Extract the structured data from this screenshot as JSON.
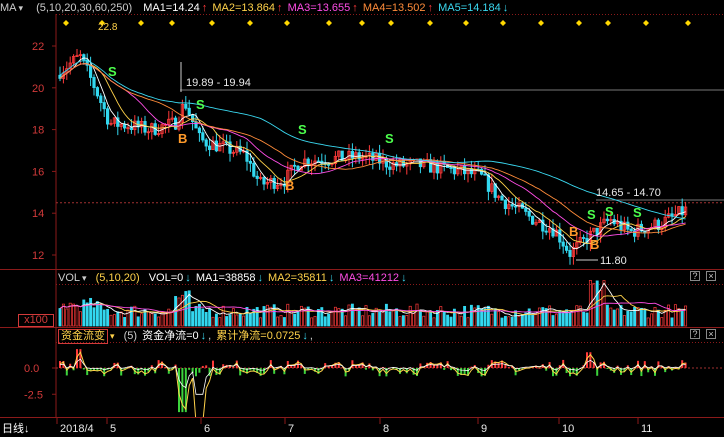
{
  "kline": {
    "indicator_name": "MA",
    "params": "(5,10,20,30,60,250)",
    "ma": [
      {
        "label": "MA1=14.24",
        "arrow": "↑",
        "color": "#ffffff"
      },
      {
        "label": "MA2=13.864",
        "arrow": "↑",
        "color": "#ffd24a"
      },
      {
        "label": "MA3=13.655",
        "arrow": "↑",
        "color": "#ff4de6"
      },
      {
        "label": "MA4=13.502",
        "arrow": "↑",
        "color": "#ff8c3a"
      },
      {
        "label": "MA5=14.184",
        "arrow": "↓",
        "color": "#3ad8f0"
      }
    ],
    "y_ticks": [
      "22",
      "20",
      "18",
      "16",
      "14",
      "12"
    ],
    "annotations": {
      "high_range": "19.89 - 19.94",
      "right_range": "14.65 - 14.70",
      "low": "11.80",
      "top_value": "22.8"
    },
    "signals": [
      {
        "type": "S",
        "x": 108,
        "y": 76
      },
      {
        "type": "S",
        "x": 196,
        "y": 109
      },
      {
        "type": "S",
        "x": 298,
        "y": 134
      },
      {
        "type": "S",
        "x": 385,
        "y": 143
      },
      {
        "type": "S",
        "x": 587,
        "y": 219
      },
      {
        "type": "S",
        "x": 605,
        "y": 216
      },
      {
        "type": "S",
        "x": 633,
        "y": 217
      },
      {
        "type": "B",
        "x": 178,
        "y": 143
      },
      {
        "type": "B",
        "x": 285,
        "y": 190
      },
      {
        "type": "B",
        "x": 569,
        "y": 236
      },
      {
        "type": "B",
        "x": 590,
        "y": 249
      }
    ]
  },
  "volume": {
    "indicator_name": "VOL",
    "params": "(5,10,20)",
    "vol": "VOL=0",
    "vol_arrow": "↓",
    "ma": [
      {
        "label": "MA1=38858",
        "arrow": "↓",
        "color": "#ffffff"
      },
      {
        "label": "MA2=35811",
        "arrow": "↓",
        "color": "#ffd24a"
      },
      {
        "label": "MA3=41212",
        "arrow": "↓",
        "color": "#ff4de6"
      }
    ],
    "unit_label": "x100"
  },
  "flow": {
    "indicator_name": "资金流变",
    "params": "(5)",
    "net": "资金净流=0",
    "net_arrow": "↓",
    "cum": "累计净流=0.0725",
    "cum_arrow": "↓",
    "cum_tail": ",",
    "y_ticks": [
      "0.0",
      "-2.5",
      "-5.0"
    ]
  },
  "xaxis": {
    "period_label": "日线",
    "period_arrow": "↓",
    "labels": [
      "2018/4",
      "5",
      "6",
      "7",
      "8",
      "9",
      "10",
      "11"
    ]
  },
  "colors": {
    "up": "#ff3a3a",
    "down": "#33d8f0",
    "grid": "#8b1a1a",
    "signal_s": "#4dff4d",
    "signal_b": "#ff9a2a",
    "diamond": "#ffd700"
  }
}
